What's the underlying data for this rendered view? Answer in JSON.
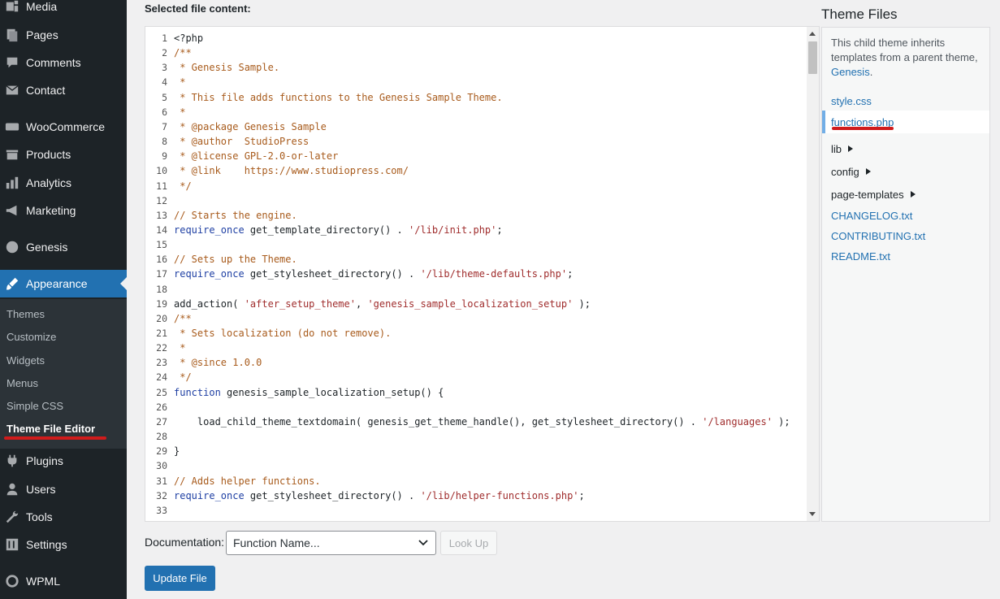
{
  "sidebar": {
    "menu": [
      {
        "label": "Media",
        "icon": "media-icon"
      },
      {
        "label": "Pages",
        "icon": "pages-icon"
      },
      {
        "label": "Comments",
        "icon": "comments-icon"
      },
      {
        "label": "Contact",
        "icon": "mail-icon"
      },
      {
        "label": "WooCommerce",
        "icon": "woocommerce-icon"
      },
      {
        "label": "Products",
        "icon": "products-icon"
      },
      {
        "label": "Analytics",
        "icon": "analytics-icon"
      },
      {
        "label": "Marketing",
        "icon": "megaphone-icon"
      },
      {
        "label": "Genesis",
        "icon": "genesis-icon"
      },
      {
        "label": "Appearance",
        "icon": "brush-icon"
      },
      {
        "label": "Plugins",
        "icon": "plugin-icon"
      },
      {
        "label": "Users",
        "icon": "users-icon"
      },
      {
        "label": "Tools",
        "icon": "tools-icon"
      },
      {
        "label": "Settings",
        "icon": "settings-icon"
      },
      {
        "label": "WPML",
        "icon": "wpml-icon"
      }
    ],
    "submenu": [
      "Themes",
      "Customize",
      "Widgets",
      "Menus",
      "Simple CSS",
      "Theme File Editor"
    ]
  },
  "editor": {
    "label": "Selected file content:",
    "lines": [
      {
        "n": "1",
        "t": "<?php"
      },
      {
        "n": "2",
        "t": "/**"
      },
      {
        "n": "3",
        "t": " * Genesis Sample."
      },
      {
        "n": "4",
        "t": " *"
      },
      {
        "n": "5",
        "t": " * This file adds functions to the Genesis Sample Theme."
      },
      {
        "n": "6",
        "t": " *"
      },
      {
        "n": "7",
        "t": " * @package Genesis Sample"
      },
      {
        "n": "8",
        "t": " * @author  StudioPress"
      },
      {
        "n": "9",
        "t": " * @license GPL-2.0-or-later"
      },
      {
        "n": "10",
        "t": " * @link    https://www.studiopress.com/"
      },
      {
        "n": "11",
        "t": " */"
      },
      {
        "n": "12",
        "t": ""
      },
      {
        "n": "13",
        "t": "// Starts the engine."
      },
      {
        "n": "14",
        "t": "require_once get_template_directory() . '/lib/init.php';"
      },
      {
        "n": "15",
        "t": ""
      },
      {
        "n": "16",
        "t": "// Sets up the Theme."
      },
      {
        "n": "17",
        "t": "require_once get_stylesheet_directory() . '/lib/theme-defaults.php';"
      },
      {
        "n": "18",
        "t": ""
      },
      {
        "n": "19",
        "t": "add_action( 'after_setup_theme', 'genesis_sample_localization_setup' );"
      },
      {
        "n": "20",
        "t": "/**"
      },
      {
        "n": "21",
        "t": " * Sets localization (do not remove)."
      },
      {
        "n": "22",
        "t": " *"
      },
      {
        "n": "23",
        "t": " * @since 1.0.0"
      },
      {
        "n": "24",
        "t": " */"
      },
      {
        "n": "25",
        "t": "function genesis_sample_localization_setup() {"
      },
      {
        "n": "26",
        "t": ""
      },
      {
        "n": "27",
        "t": "    load_child_theme_textdomain( genesis_get_theme_handle(), get_stylesheet_directory() . '/languages' );"
      },
      {
        "n": "28",
        "t": ""
      },
      {
        "n": "29",
        "t": "}"
      },
      {
        "n": "30",
        "t": ""
      },
      {
        "n": "31",
        "t": "// Adds helper functions."
      },
      {
        "n": "32",
        "t": "require_once get_stylesheet_directory() . '/lib/helper-functions.php';"
      },
      {
        "n": "33",
        "t": ""
      }
    ]
  },
  "documentation": {
    "label": "Documentation:",
    "select_value": "Function Name...",
    "lookup_label": "Look Up"
  },
  "update_label": "Update File",
  "theme_files": {
    "title": "Theme Files",
    "note_prefix": "This child theme inherits templates from a parent theme, ",
    "note_link": "Genesis",
    "note_suffix": ".",
    "files": [
      {
        "label": "style.css",
        "type": "file"
      },
      {
        "label": "functions.php",
        "type": "file",
        "current": true
      },
      {
        "label": "lib",
        "type": "folder"
      },
      {
        "label": "config",
        "type": "folder"
      },
      {
        "label": "page-templates",
        "type": "folder"
      },
      {
        "label": "CHANGELOG.txt",
        "type": "file"
      },
      {
        "label": "CONTRIBUTING.txt",
        "type": "file"
      },
      {
        "label": "README.txt",
        "type": "file"
      }
    ]
  },
  "colors": {
    "sidebar_bg": "#1d2327",
    "accent": "#2271b1",
    "annotation_red": "#d01b1b"
  }
}
